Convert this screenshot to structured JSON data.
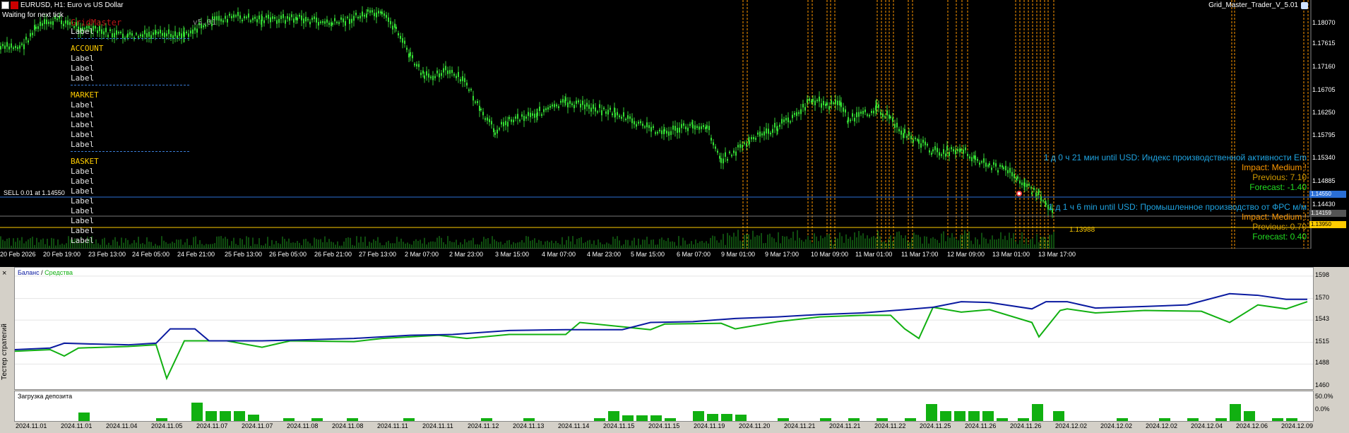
{
  "header": {
    "symbol_title": "EURUSD, H1:  Euro vs US Dollar",
    "status": "Waiting for next tick",
    "ea_name": "Grid_Master_Trader_V_5.01",
    "overlay_title": "GridMaster",
    "overlay_version": "v5.01"
  },
  "panel": {
    "top_label": "Label",
    "sections": [
      {
        "title": "ACCOUNT",
        "labels": [
          "Label",
          "Label",
          "Label"
        ]
      },
      {
        "title": "MARKET",
        "labels": [
          "Label",
          "Label",
          "Label",
          "Label",
          "Label"
        ]
      },
      {
        "title": "BASKET",
        "labels": [
          "Label",
          "Label",
          "Label",
          "Label",
          "Label",
          "Label",
          "Label",
          "Label"
        ]
      }
    ]
  },
  "news": [
    {
      "title": "1 д 0 ч 21 мин until USD: Индекс производственной активности Em",
      "impact": "Impact: Medium !",
      "previous": "Previous: 7.10",
      "forecast": "Forecast: -1.40"
    },
    {
      "title": "1 д 1 ч 6 min until USD: Промышленное производство от ФРС м/м",
      "impact": "Impact: Medium !",
      "previous": "Previous: 0.70",
      "forecast": "Forecast: 0.40"
    }
  ],
  "order_line_label": "SELL 0.01 at 1.14550",
  "level_label": "1.13988",
  "price_axis": [
    "1.18070",
    "1.17615",
    "1.17160",
    "1.16705",
    "1.16250",
    "1.15795",
    "1.15340",
    "1.14885",
    "1.14430"
  ],
  "price_tags": [
    {
      "text": "1.14550",
      "color": "#2b6fd6",
      "fg": "#ffffff"
    },
    {
      "text": "1.14159",
      "color": "#555555",
      "fg": "#ffffff"
    },
    {
      "text": "1.13950",
      "color": "#ffcc00",
      "fg": "#000000"
    }
  ],
  "time_axis": [
    "20 Feb 2026",
    "20 Feb 19:00",
    "23 Feb 13:00",
    "24 Feb 05:00",
    "24 Feb 21:00",
    "25 Feb 13:00",
    "26 Feb 05:00",
    "26 Feb 21:00",
    "27 Feb 13:00",
    "2 Mar 07:00",
    "2 Mar 23:00",
    "3 Mar 15:00",
    "4 Mar 07:00",
    "4 Mar 23:00",
    "5 Mar 15:00",
    "6 Mar 07:00",
    "9 Mar 01:00",
    "9 Mar 17:00",
    "10 Mar 09:00",
    "11 Mar 01:00",
    "11 Mar 17:00",
    "12 Mar 09:00",
    "13 Mar 01:00",
    "13 Mar 17:00"
  ],
  "tester": {
    "close_label": "×",
    "side_label": "Тестер стратегий",
    "legend_balance": "Баланс",
    "legend_sep": " / ",
    "legend_equity": "Средства",
    "deposit_label": "Загрузка депозита",
    "balance_axis": [
      "1598",
      "1570",
      "1543",
      "1515",
      "1488",
      "1460"
    ],
    "deposit_axis": [
      "50.0%",
      "0.0%"
    ],
    "dates": [
      "2024.11.01",
      "2024.11.01",
      "2024.11.04",
      "2024.11.05",
      "2024.11.07",
      "2024.11.07",
      "2024.11.08",
      "2024.11.08",
      "2024.11.11",
      "2024.11.11",
      "2024.11.12",
      "2024.11.13",
      "2024.11.14",
      "2024.11.15",
      "2024.11.15",
      "2024.11.19",
      "2024.11.20",
      "2024.11.21",
      "2024.11.21",
      "2024.11.22",
      "2024.11.25",
      "2024.11.26",
      "2024.11.26",
      "2024.12.02",
      "2024.12.02",
      "2024.12.02",
      "2024.12.04",
      "2024.12.06",
      "2024.12.09"
    ],
    "colors": {
      "balance": "#0a1aa0",
      "equity": "#11b011",
      "deposit": "#11b011"
    }
  }
}
